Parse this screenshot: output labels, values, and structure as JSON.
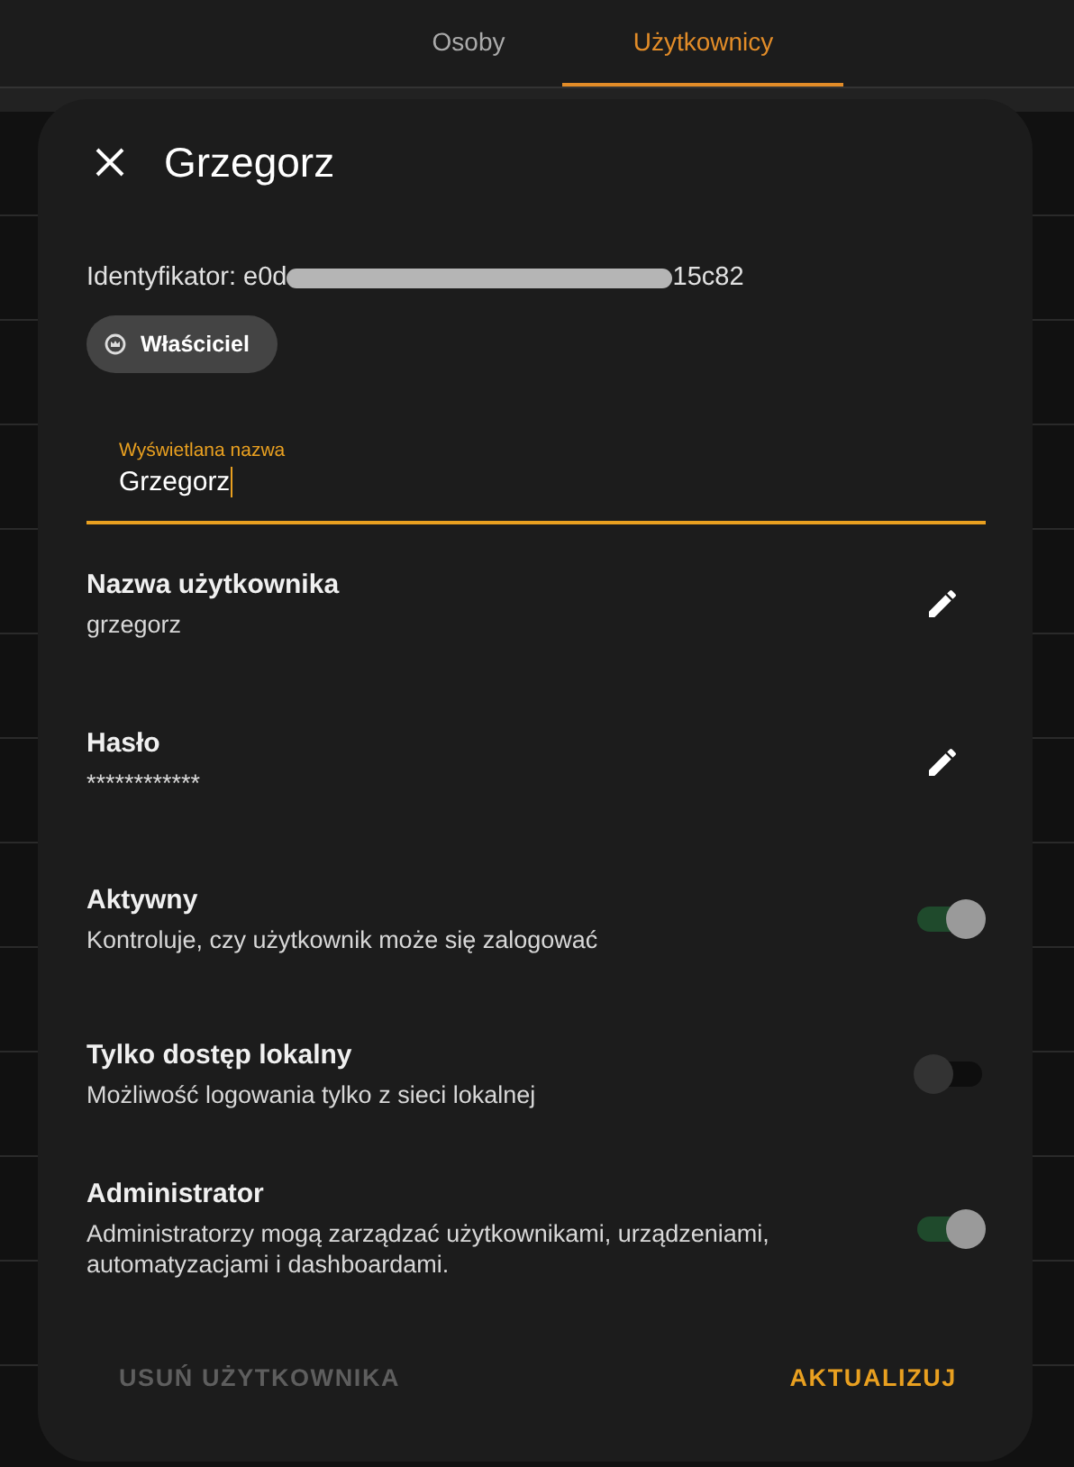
{
  "tabs": [
    {
      "label": "Osoby",
      "selected": false
    },
    {
      "label": "Użytkownicy",
      "selected": true
    }
  ],
  "dialog": {
    "title": "Grzegorz",
    "identifier_prefix": "Identyfikator: e0d",
    "identifier_suffix": "15c82",
    "chip": "Właściciel",
    "display_name": {
      "label": "Wyświetlana nazwa",
      "value": "Grzegorz"
    },
    "fields": [
      {
        "label": "Nazwa użytkownika",
        "value": "grzegorz"
      },
      {
        "label": "Hasło",
        "value": "************"
      }
    ],
    "switches": [
      {
        "label": "Aktywny",
        "description": "Kontroluje, czy użytkownik może się zalogować",
        "on": true
      },
      {
        "label": "Tylko dostęp lokalny",
        "description": "Możliwość logowania tylko z sieci lokalnej",
        "on": false
      },
      {
        "label": "Administrator",
        "description": "Administratorzy mogą zarządzać użytkownikami, urządzeniami, automatyzacjami i dashboardami.",
        "on": true
      }
    ],
    "delete_button": {
      "label": "USUŃ UŻYTKOWNIKA",
      "disabled": true
    },
    "update_button": {
      "label": "AKTUALIZUJ"
    }
  }
}
